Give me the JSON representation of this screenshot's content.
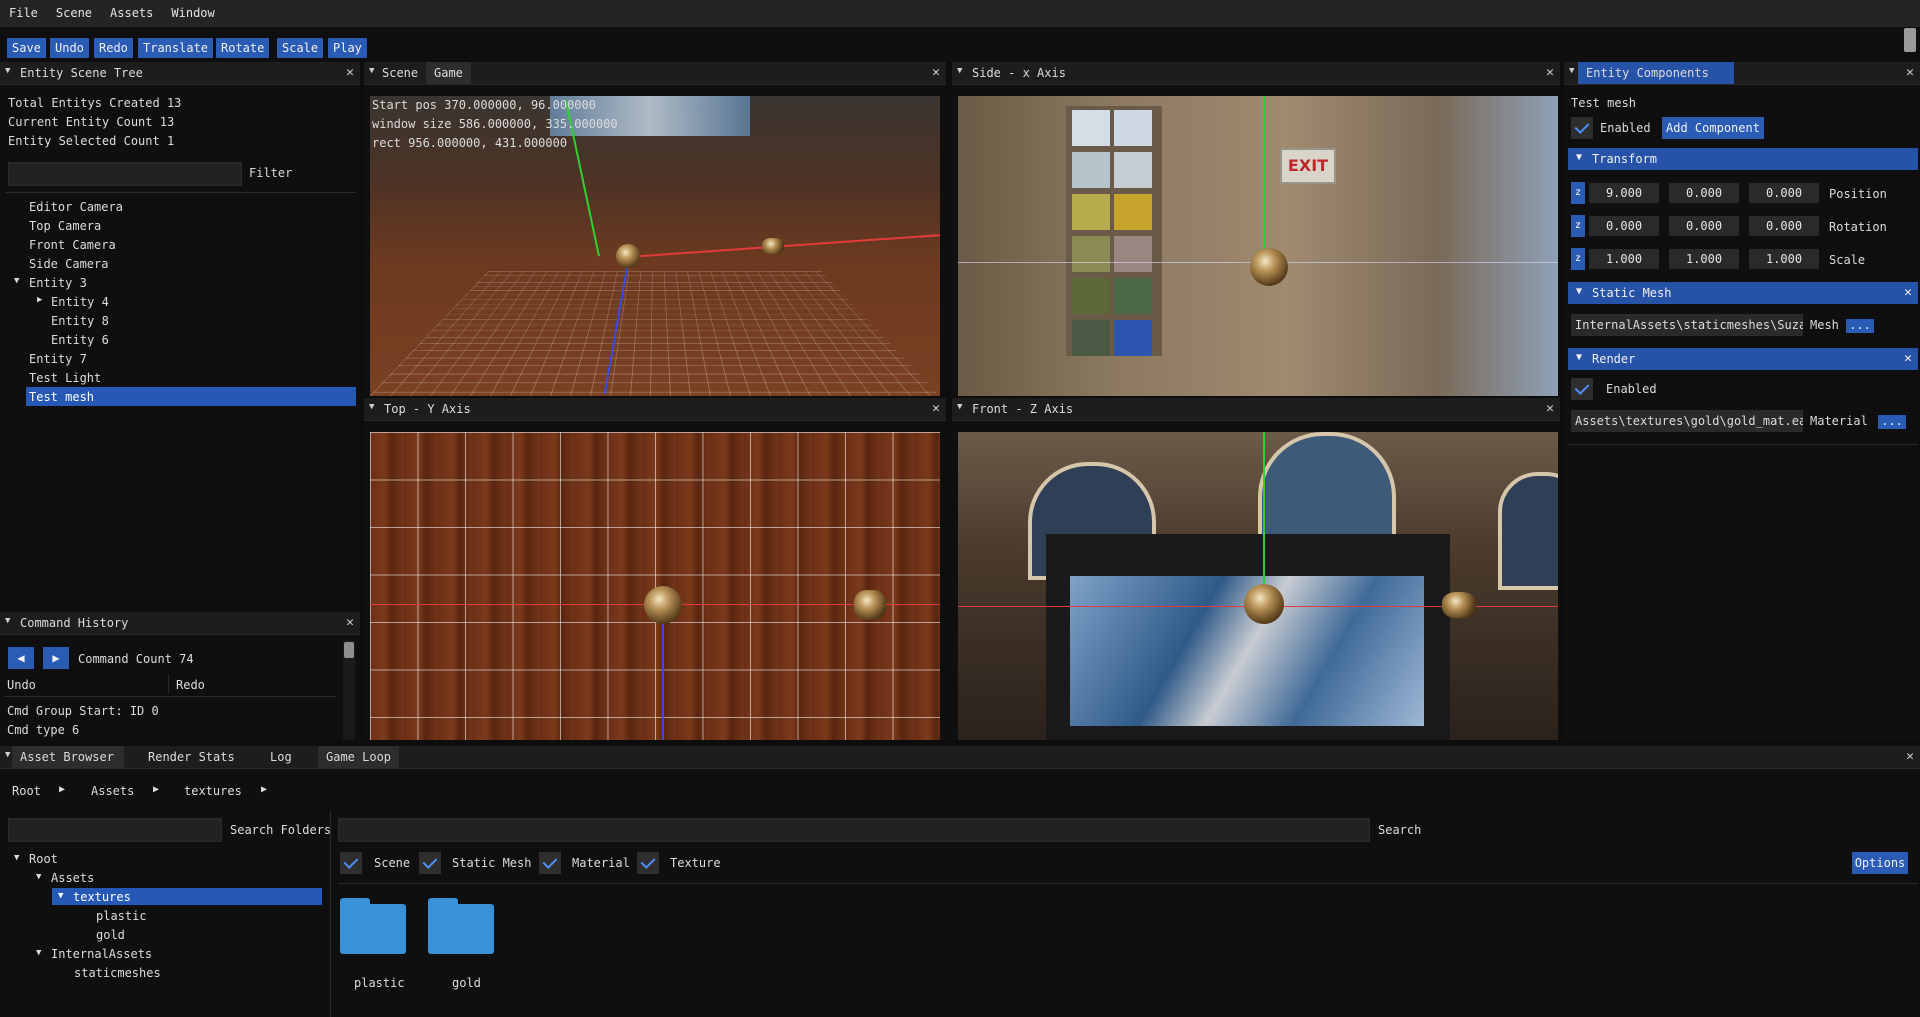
{
  "menu": [
    "File",
    "Scene",
    "Assets",
    "Window"
  ],
  "toolbar": [
    "Save",
    "Undo",
    "Redo",
    "Translate",
    "Rotate",
    "Scale",
    "Play"
  ],
  "scene_tree": {
    "title": "Entity Scene Tree",
    "stats": [
      "Total Entitys Created 13",
      "Current Entity Count 13",
      "Entity Selected Count 1"
    ],
    "filter_label": "Filter",
    "items": [
      "Editor Camera",
      "Top Camera",
      "Front Camera",
      "Side Camera",
      "Entity 3",
      "Entity 4",
      "Entity 8",
      "Entity 6",
      "Entity 7",
      "Test Light",
      "Test mesh"
    ]
  },
  "command_history": {
    "title": "Command History",
    "count": "Command Count 74",
    "undo": "Undo",
    "redo": "Redo",
    "lines": [
      "Cmd Group Start: ID 0",
      "Cmd type 6"
    ]
  },
  "viewports": {
    "scene_tab": "Scene",
    "game_tab": "Game",
    "scene_info": [
      "Start pos 370.000000, 96.000000",
      "window size 586.000000, 335.000000",
      "rect 956.000000, 431.000000"
    ],
    "side": "Side - x Axis",
    "top": "Top - Y Axis",
    "front": "Front - Z Axis",
    "exit_sign": "EXIT"
  },
  "components": {
    "title": "Entity Components",
    "entity_name": "Test mesh",
    "enabled": "Enabled",
    "add_component": "Add Component",
    "transform": "Transform",
    "rows": [
      {
        "z": "z",
        "v": [
          "9.000",
          "0.000",
          "0.000"
        ],
        "label": "Position"
      },
      {
        "z": "z",
        "v": [
          "0.000",
          "0.000",
          "0.000"
        ],
        "label": "Rotation"
      },
      {
        "z": "z",
        "v": [
          "1.000",
          "1.000",
          "1.000"
        ],
        "label": "Scale"
      }
    ],
    "static_mesh": "Static Mesh",
    "mesh_path": "InternalAssets\\staticmeshes\\Suzar",
    "mesh_label": "Mesh",
    "dots": "...",
    "render": "Render",
    "render_enabled": "Enabled",
    "material_path": "Assets\\textures\\gold\\gold_mat.ea:",
    "material_label": "Material"
  },
  "asset_browser": {
    "tabs": [
      "Asset Browser",
      "Render Stats",
      "Log",
      "Game Loop"
    ],
    "breadcrumb": [
      "Root",
      "Assets",
      "textures"
    ],
    "search_folders": "Search Folders",
    "search": "Search",
    "filters": [
      "Scene",
      "Static Mesh",
      "Material",
      "Texture"
    ],
    "options": "Options",
    "tree": [
      "Root",
      "Assets",
      "textures",
      "plastic",
      "gold",
      "InternalAssets",
      "staticmeshes"
    ],
    "folders": [
      "plastic",
      "gold"
    ]
  },
  "colors": {
    "accent": "#2a5cb6",
    "selection": "#2659b5",
    "check": "#4f8ff7",
    "folder": "#3a91d8"
  }
}
